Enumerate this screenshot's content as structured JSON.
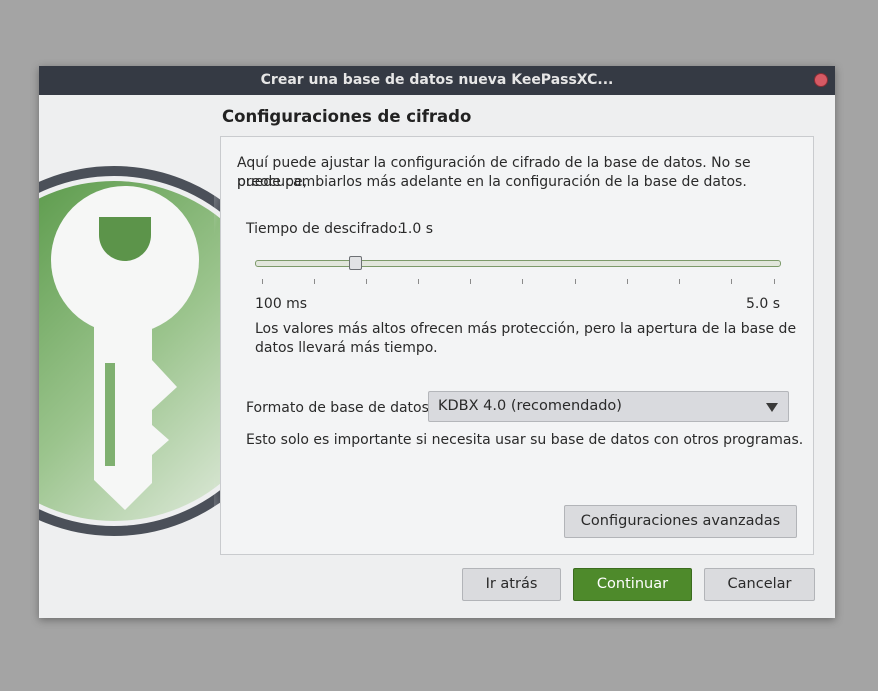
{
  "window": {
    "title": "Crear una base de datos nueva KeePassXC..."
  },
  "colors": {
    "accent": "#4e8a2b",
    "titlebar": "#353a44",
    "close": "#d65a64"
  },
  "section": {
    "title": "Configuraciones de cifrado"
  },
  "intro": {
    "line1": "Aquí puede ajustar la configuración de cifrado de la base de datos. No se preocupe,",
    "line2": "puede cambiarlos más adelante en la configuración de la base de datos."
  },
  "decryption": {
    "label": "Tiempo de descifrado:",
    "value": "1.0 s",
    "min_label": "100 ms",
    "max_label": "5.0 s",
    "note_line1": "Los valores más altos ofrecen más protección, pero la apertura de la base de",
    "note_line2": "datos llevará más tiempo."
  },
  "format": {
    "label": "Formato de base de datos:",
    "selected": "KDBX 4.0 (recomendado)",
    "note": "Esto solo es importante si necesita usar su base de datos con otros programas."
  },
  "buttons": {
    "advanced": "Configuraciones avanzadas",
    "back": "Ir atrás",
    "continue": "Continuar",
    "cancel": "Cancelar"
  },
  "icons": {
    "close": "close-icon",
    "logo": "keepassxc-logo-icon",
    "dropdown": "chevron-down-icon"
  }
}
